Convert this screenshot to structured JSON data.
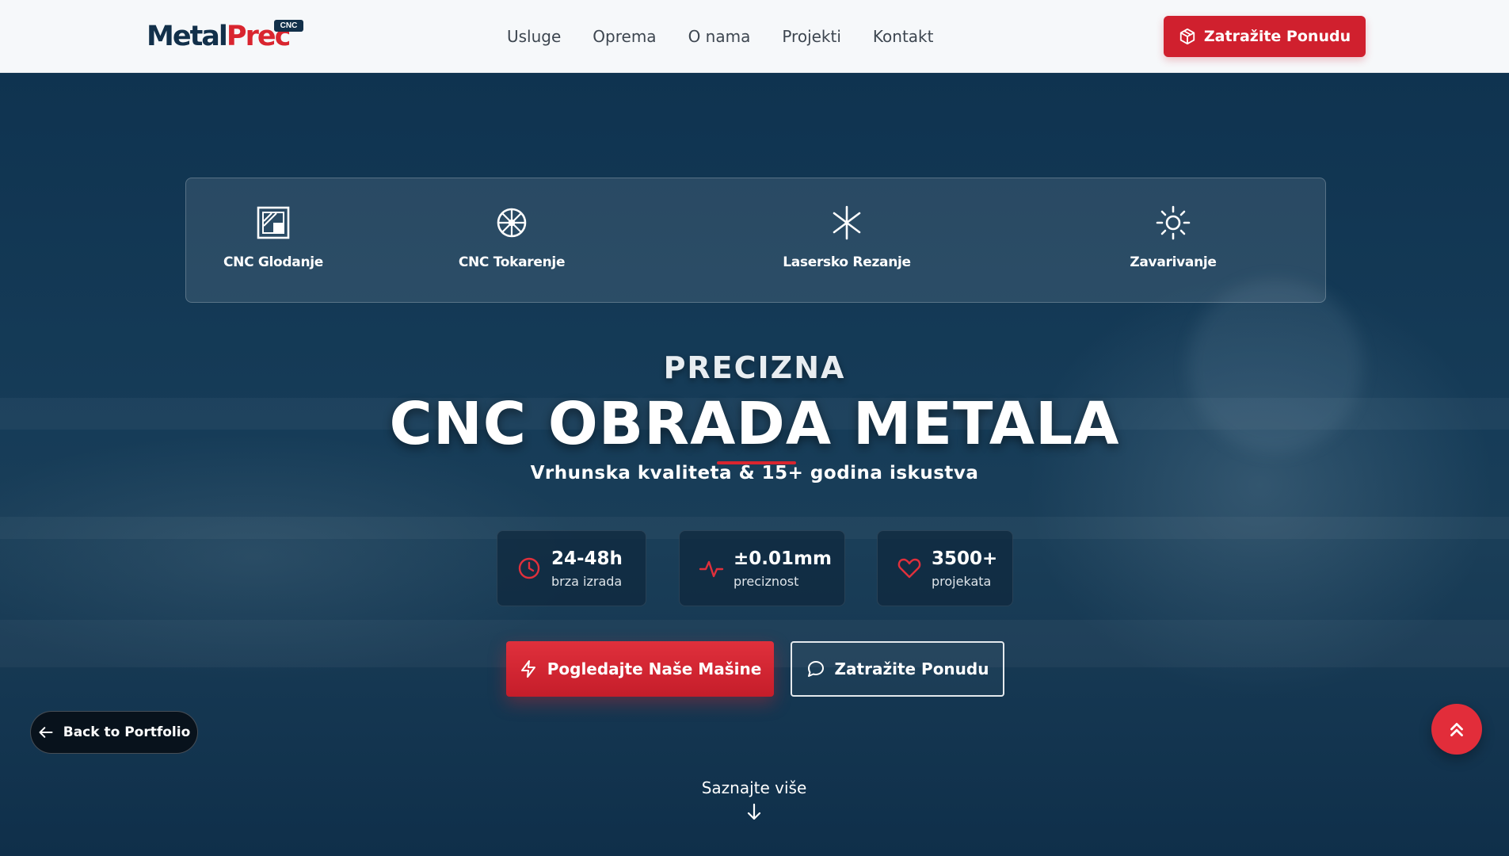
{
  "brand": {
    "name_part1": "Metal",
    "name_part2": "Prec",
    "badge": "CNC",
    "primary_color": "#12304a",
    "accent_color": "#d9252f"
  },
  "nav": {
    "items": [
      {
        "label": "Usluge"
      },
      {
        "label": "Oprema"
      },
      {
        "label": "O nama"
      },
      {
        "label": "Projekti"
      },
      {
        "label": "Kontakt"
      }
    ],
    "cta_label": "Zatražite Ponudu",
    "cta_icon": "cube-icon"
  },
  "services": [
    {
      "label": "CNC Glodanje",
      "icon": "milling-icon"
    },
    {
      "label": "CNC Tokarenje",
      "icon": "lathe-wheel-icon"
    },
    {
      "label": "Lasersko Rezanje",
      "icon": "laser-icon"
    },
    {
      "label": "Zavarivanje",
      "icon": "welding-spark-icon"
    }
  ],
  "hero": {
    "pre_title": "PRECIZNA",
    "title": "CNC OBRADA METALA",
    "subtitle": "Vrhunska kvaliteta & 15+ godina iskustva"
  },
  "stats": [
    {
      "value": "24-48h",
      "label": "brza izrada",
      "icon": "clock-icon"
    },
    {
      "value": "±0.01mm",
      "label": "preciznost",
      "icon": "activity-icon"
    },
    {
      "value": "3500+",
      "label": "projekata",
      "icon": "heart-icon"
    }
  ],
  "buttons": {
    "primary_label": "Pogledajte Naše Mašine",
    "primary_icon": "lightning-icon",
    "secondary_label": "Zatražite Ponudu",
    "secondary_icon": "chat-bubble-icon"
  },
  "learn_more": "Saznajte više",
  "back_to_portfolio": "Back to Portfolio"
}
